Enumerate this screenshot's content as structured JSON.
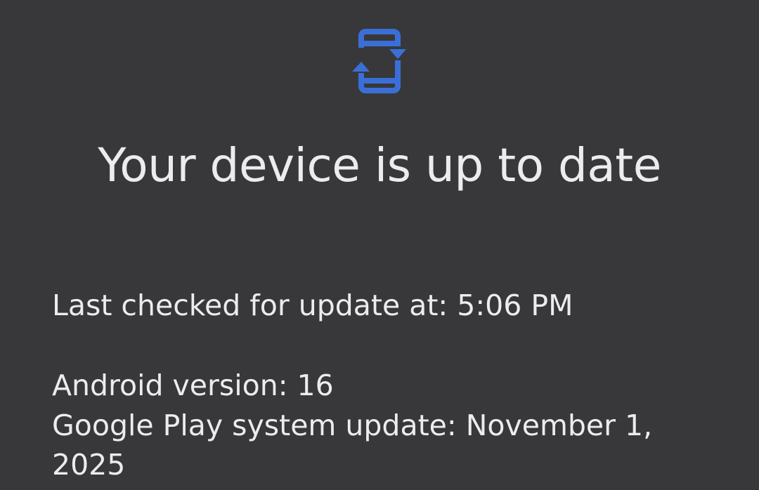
{
  "status": {
    "icon": "system-update-icon",
    "title": "Your device is up to date"
  },
  "details": {
    "last_checked": "Last checked for update at: 5:06 PM",
    "android_version": "Android version: 16",
    "play_system_update": "Google Play system update: November 1, 2025"
  },
  "colors": {
    "background": "#38383a",
    "text": "#ececf0",
    "accent": "#3a6fd8"
  }
}
